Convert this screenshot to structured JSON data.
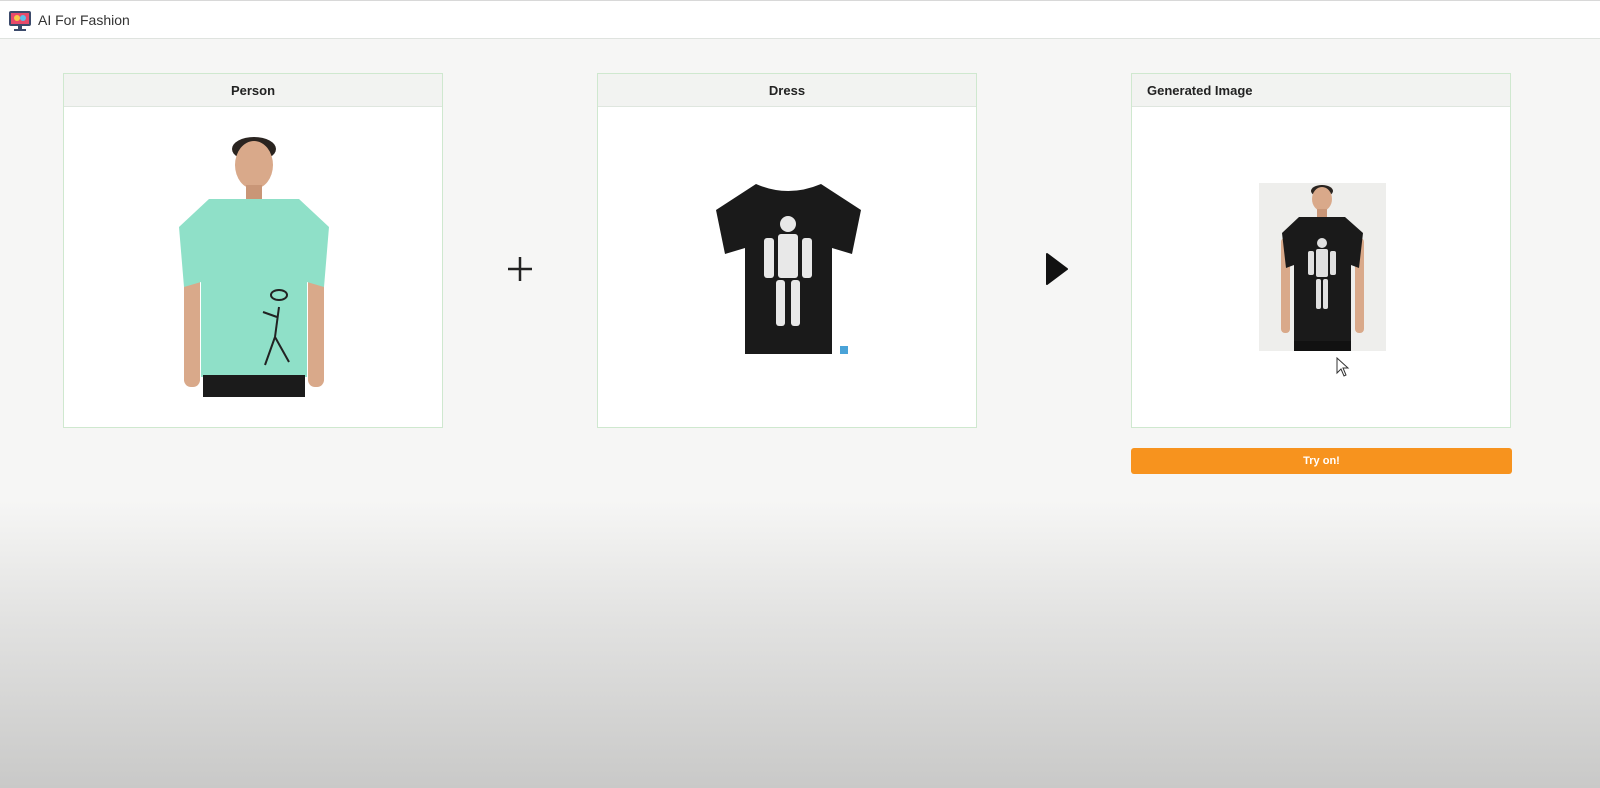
{
  "app": {
    "title": "AI For Fashion",
    "logo_icon": "ai-fashion-logo-icon"
  },
  "panels": [
    {
      "label": "Person",
      "image": "person-in-mint-tshirt-image"
    },
    {
      "label": "Dress",
      "image": "black-robot-print-tshirt-image"
    },
    {
      "label": "Generated Image",
      "image": "person-in-black-robot-tshirt-image"
    }
  ],
  "operators": {
    "plus_icon": "plus-icon",
    "arrow_icon": "play-arrow-icon"
  },
  "actions": {
    "try_on_label": "Try on!"
  },
  "colors": {
    "accent": "#f7931e",
    "panel_border": "#cfe8cf",
    "header_bg": "#f2f3f1",
    "mint_shirt": "#8fe0c8",
    "dark_shirt": "#1a1a1a"
  }
}
